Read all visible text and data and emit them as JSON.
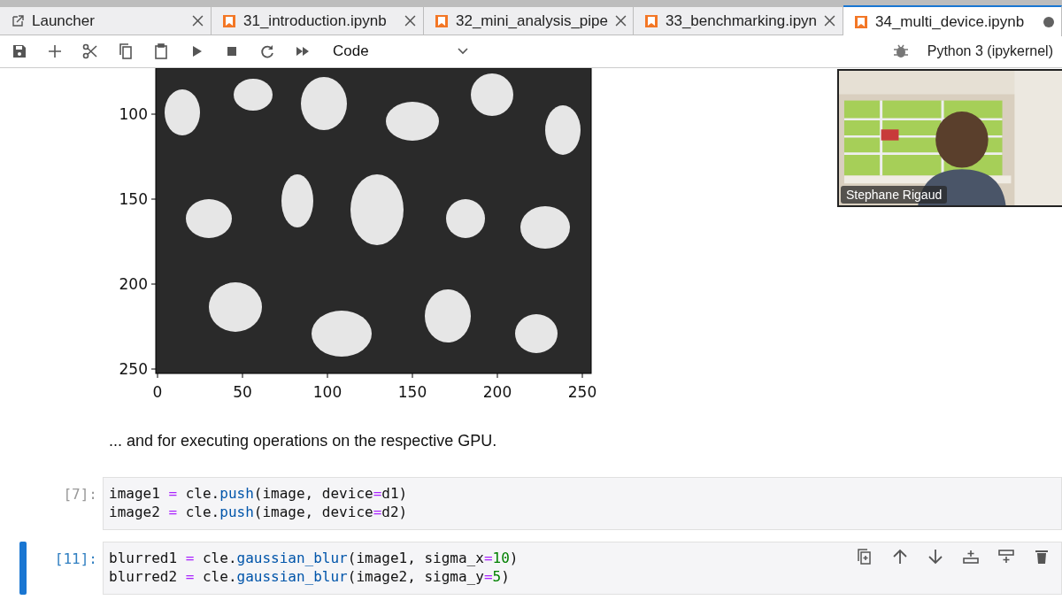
{
  "tabs": [
    {
      "label": "Launcher",
      "kind": "launcher",
      "selected": false,
      "modified": false
    },
    {
      "label": "31_introduction.ipynb",
      "kind": "notebook",
      "selected": false,
      "modified": false
    },
    {
      "label": "32_mini_analysis_pipe",
      "kind": "notebook",
      "selected": false,
      "modified": false
    },
    {
      "label": "33_benchmarking.ipyn",
      "kind": "notebook",
      "selected": false,
      "modified": false
    },
    {
      "label": "34_multi_device.ipynb",
      "kind": "notebook",
      "selected": true,
      "modified": true
    }
  ],
  "toolbar": {
    "buttons": [
      {
        "kind": "save"
      },
      {
        "kind": "add"
      },
      {
        "kind": "cut"
      },
      {
        "kind": "copy"
      },
      {
        "kind": "paste"
      },
      {
        "kind": "run"
      },
      {
        "kind": "stop"
      },
      {
        "kind": "restart"
      },
      {
        "kind": "run-all"
      }
    ],
    "cell_type": "Code",
    "kernel": "Python 3 (ipykernel)"
  },
  "plot": {
    "xticks": [
      "0",
      "50",
      "100",
      "150",
      "200",
      "250"
    ],
    "yticks": [
      "100",
      "150",
      "200",
      "250"
    ]
  },
  "markdown": "... and for executing operations on the respective GPU.",
  "cells": [
    {
      "prompt": "[7]:",
      "selected": false,
      "lines": [
        [
          {
            "text": "image1 ",
            "kind": "name"
          },
          {
            "text": "=",
            "kind": "op"
          },
          {
            "text": " cle.",
            "kind": "name"
          },
          {
            "text": "push",
            "kind": "func"
          },
          {
            "text": "(image, device",
            "kind": "name"
          },
          {
            "text": "=",
            "kind": "op"
          },
          {
            "text": "d1)",
            "kind": "name"
          }
        ],
        [
          {
            "text": "image2 ",
            "kind": "name"
          },
          {
            "text": "=",
            "kind": "op"
          },
          {
            "text": " cle.",
            "kind": "name"
          },
          {
            "text": "push",
            "kind": "func"
          },
          {
            "text": "(image, device",
            "kind": "name"
          },
          {
            "text": "=",
            "kind": "op"
          },
          {
            "text": "d2)",
            "kind": "name"
          }
        ]
      ]
    },
    {
      "prompt": "[11]:",
      "selected": true,
      "lines": [
        [
          {
            "text": "blurred1 ",
            "kind": "name"
          },
          {
            "text": "=",
            "kind": "op"
          },
          {
            "text": " cle.",
            "kind": "name"
          },
          {
            "text": "gaussian_blur",
            "kind": "func"
          },
          {
            "text": "(image1, sigma_x",
            "kind": "name"
          },
          {
            "text": "=",
            "kind": "op"
          },
          {
            "text": "10",
            "kind": "num"
          },
          {
            "text": ")",
            "kind": "name"
          }
        ],
        [
          {
            "text": "blurred2 ",
            "kind": "name"
          },
          {
            "text": "=",
            "kind": "op"
          },
          {
            "text": " cle.",
            "kind": "name"
          },
          {
            "text": "gaussian_blur",
            "kind": "func"
          },
          {
            "text": "(image2, sigma_y",
            "kind": "name"
          },
          {
            "text": "=",
            "kind": "op"
          },
          {
            "text": "5",
            "kind": "num"
          },
          {
            "text": ")",
            "kind": "name"
          }
        ]
      ]
    }
  ],
  "cell_actions": [
    {
      "kind": "duplicate"
    },
    {
      "kind": "move-up"
    },
    {
      "kind": "move-down"
    },
    {
      "kind": "insert-above"
    },
    {
      "kind": "insert-below"
    },
    {
      "kind": "delete"
    }
  ],
  "video": {
    "name": "Stephane Rigaud"
  }
}
